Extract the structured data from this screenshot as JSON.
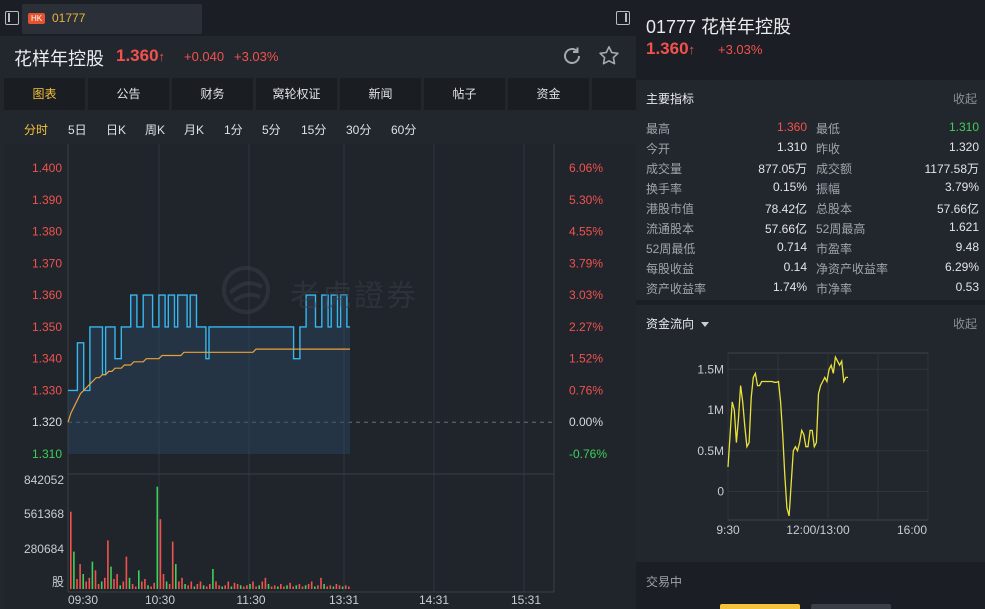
{
  "tab": {
    "market": "HK",
    "code": "01777"
  },
  "stock": {
    "name": "花样年控股",
    "price": "1.360",
    "price_arrow": "↑",
    "change": "+0.040",
    "change_pct": "+3.03%"
  },
  "menu": [
    "图表",
    "公告",
    "财务",
    "窝轮权证",
    "新闻",
    "帖子",
    "资金"
  ],
  "periods": [
    "分时",
    "5日",
    "日K",
    "周K",
    "月K",
    "1分",
    "5分",
    "15分",
    "30分",
    "60分"
  ],
  "watermark": "老虎證券",
  "colors": {
    "up": "#f2524e",
    "down": "#3fcf5a",
    "accent": "#f4c23b",
    "price_line": "#36b7f0",
    "avg_line": "#e8a23a"
  },
  "chart_data": {
    "type": "line",
    "y_price_ticks": [
      "1.400",
      "1.390",
      "1.380",
      "1.370",
      "1.360",
      "1.350",
      "1.340",
      "1.330",
      "1.320",
      "1.310"
    ],
    "y_pct_ticks": [
      "6.06%",
      "5.30%",
      "4.55%",
      "3.79%",
      "3.03%",
      "2.27%",
      "1.52%",
      "0.76%",
      "0.00%",
      "-0.76%"
    ],
    "ylim": [
      1.31,
      1.4
    ],
    "prev_close": 1.32,
    "x_ticks": [
      "09:30",
      "10:30",
      "11:30",
      "13:31",
      "14:31",
      "15:31"
    ],
    "volume_ticks": [
      "842052",
      "561368",
      "280684",
      "股"
    ],
    "volume_max": 842052,
    "series": [
      {
        "name": "",
        "values": [
          1.33,
          1.33,
          1.33,
          1.345,
          1.345,
          1.33,
          1.33,
          1.35,
          1.35,
          1.35,
          1.35,
          1.335,
          1.35,
          1.35,
          1.35,
          1.34,
          1.34,
          1.35,
          1.35,
          1.35,
          1.36,
          1.36,
          1.35,
          1.35,
          1.36,
          1.36,
          1.36,
          1.35,
          1.35,
          1.36,
          1.36,
          1.35,
          1.36,
          1.36,
          1.35,
          1.36,
          1.36,
          1.36,
          1.35,
          1.36,
          1.36,
          1.35,
          1.35,
          1.35,
          1.34,
          1.35,
          1.35,
          1.35,
          1.35,
          1.35,
          1.35,
          1.35,
          1.35,
          1.35,
          1.35,
          1.35,
          1.35,
          1.35,
          1.35,
          1.35,
          1.35,
          1.35,
          1.35,
          1.35,
          1.35,
          1.35,
          1.35,
          1.35,
          1.35,
          1.35,
          1.35,
          1.35,
          1.34,
          1.34,
          1.35,
          1.35,
          1.36,
          1.36,
          1.36,
          1.35,
          1.35,
          1.36,
          1.36,
          1.35,
          1.36,
          1.36,
          1.35,
          1.36,
          1.36,
          1.35,
          1.35
        ]
      },
      {
        "name": "",
        "values": [
          1.32,
          1.323,
          1.325,
          1.327,
          1.329,
          1.33,
          1.331,
          1.332,
          1.333,
          1.334,
          1.334,
          1.335,
          1.335,
          1.336,
          1.336,
          1.337,
          1.337,
          1.337,
          1.338,
          1.338,
          1.338,
          1.339,
          1.339,
          1.339,
          1.339,
          1.34,
          1.34,
          1.34,
          1.34,
          1.34,
          1.341,
          1.341,
          1.341,
          1.341,
          1.341,
          1.341,
          1.341,
          1.342,
          1.342,
          1.342,
          1.342,
          1.342,
          1.342,
          1.342,
          1.342,
          1.342,
          1.342,
          1.342,
          1.342,
          1.342,
          1.342,
          1.342,
          1.342,
          1.342,
          1.342,
          1.342,
          1.342,
          1.342,
          1.342,
          1.342,
          1.343,
          1.343,
          1.343,
          1.343,
          1.343,
          1.343,
          1.343,
          1.343,
          1.343,
          1.343,
          1.343,
          1.343,
          1.343,
          1.343,
          1.343,
          1.343,
          1.343,
          1.343,
          1.343,
          1.343,
          1.343,
          1.343,
          1.343,
          1.343,
          1.343,
          1.343,
          1.343,
          1.343,
          1.343,
          1.343,
          1.343
        ]
      }
    ],
    "volumes": [
      620000,
      300000,
      80000,
      200000,
      120000,
      60000,
      90000,
      220000,
      150000,
      40000,
      60000,
      90000,
      390000,
      180000,
      80000,
      120000,
      30000,
      60000,
      260000,
      90000,
      40000,
      20000,
      150000,
      60000,
      80000,
      30000,
      20000,
      50000,
      820000,
      560000,
      120000,
      60000,
      40000,
      380000,
      200000,
      60000,
      90000,
      40000,
      30000,
      60000,
      20000,
      40000,
      60000,
      30000,
      20000,
      40000,
      160000,
      60000,
      30000,
      20000,
      30000,
      60000,
      20000,
      50000,
      40000,
      30000,
      20000,
      30000,
      40000,
      60000,
      20000,
      30000,
      60000,
      90000,
      40000,
      20000,
      30000,
      20000,
      40000,
      20000,
      30000,
      50000,
      20000,
      30000,
      40000,
      20000,
      30000,
      40000,
      60000,
      20000,
      30000,
      90000,
      40000,
      20000,
      30000,
      20000,
      40000,
      30000,
      20000,
      30000,
      20000
    ]
  },
  "right": {
    "title": "01777 花样年控股",
    "price": "1.360",
    "arrow": "↑",
    "pct": "+3.03%",
    "indicators_title": "主要指标",
    "collapse": "收起",
    "indicators": [
      [
        "最高",
        "1.360",
        "最低",
        "1.310"
      ],
      [
        "今开",
        "1.310",
        "昨收",
        "1.320"
      ],
      [
        "成交量",
        "877.05万",
        "成交额",
        "1177.58万"
      ],
      [
        "换手率",
        "0.15%",
        "振幅",
        "3.79%"
      ],
      [
        "港股市值",
        "78.42亿",
        "总股本",
        "57.66亿"
      ],
      [
        "流通股本",
        "57.66亿",
        "52周最高",
        "1.621"
      ],
      [
        "52周最低",
        "0.714",
        "市盈率",
        "9.48"
      ],
      [
        "每股收益",
        "0.14",
        "净资产收益率",
        "6.29%"
      ],
      [
        "资产收益率",
        "1.74%",
        "市净率",
        "0.53"
      ]
    ],
    "flow_title": "资金流向",
    "flow_chart": {
      "type": "line",
      "y_ticks": [
        "1.5M",
        "1M",
        "0.5M",
        "0"
      ],
      "ylim": [
        -0.35,
        1.7
      ],
      "x_ticks": [
        "9:30",
        "12:00/13:00",
        "16:00"
      ],
      "values": [
        0.3,
        0.7,
        1.1,
        1.0,
        0.6,
        0.9,
        1.3,
        1.1,
        0.8,
        0.55,
        0.6,
        1.15,
        1.4,
        1.45,
        1.3,
        1.3,
        1.35,
        1.35,
        1.35,
        1.35,
        1.35,
        1.35,
        1.34,
        1.34,
        1.35,
        1.1,
        0.7,
        0.2,
        -0.2,
        -0.3,
        0.1,
        0.5,
        0.55,
        0.5,
        0.6,
        0.75,
        0.7,
        0.55,
        0.55,
        0.75,
        0.75,
        0.55,
        0.6,
        1.2,
        1.3,
        1.35,
        1.4,
        1.35,
        1.5,
        1.55,
        1.45,
        1.65,
        1.6,
        1.55,
        1.6,
        1.35,
        1.4,
        1.4
      ]
    },
    "status": "交易中"
  }
}
